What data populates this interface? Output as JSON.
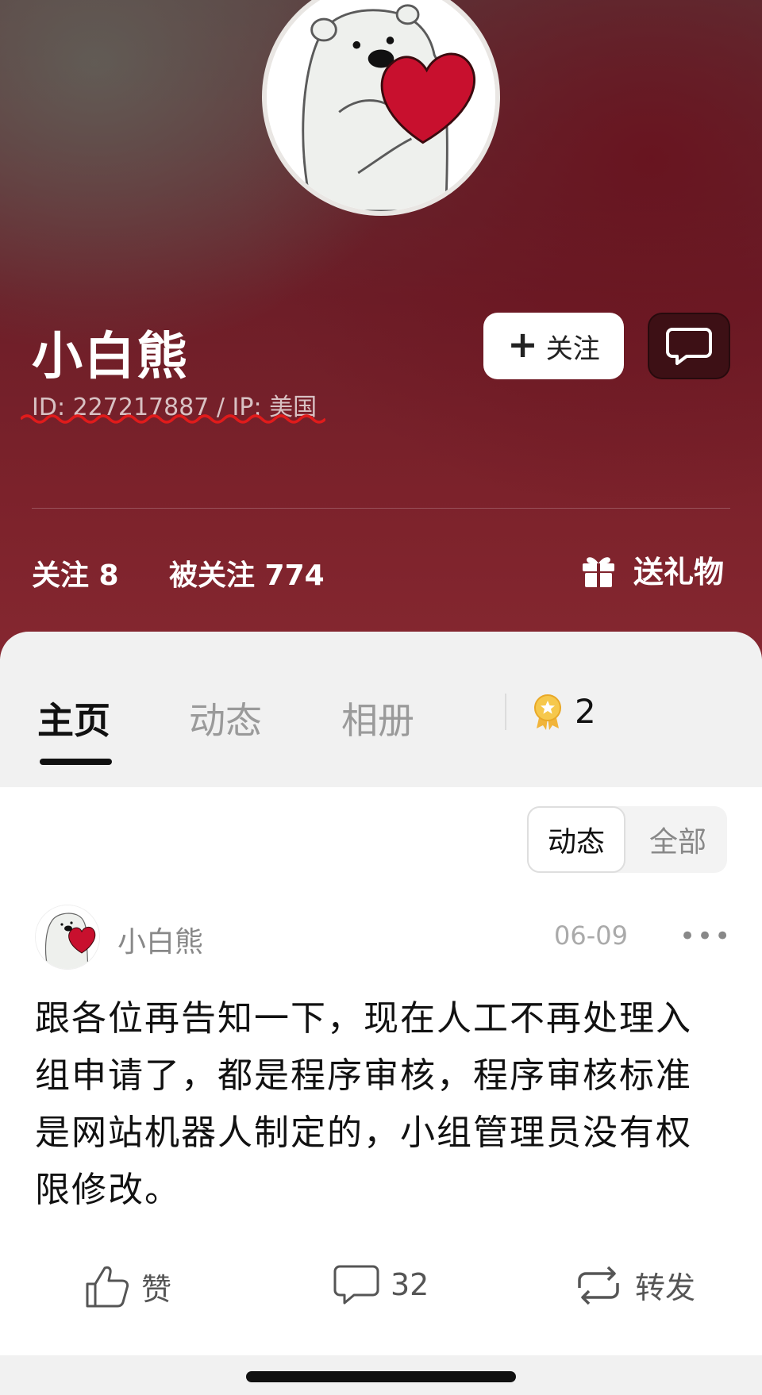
{
  "profile": {
    "name": "小白熊",
    "meta": "ID: 227217887 / IP: 美国",
    "avatar_icon": "polar-bear-heart-avatar",
    "follow_label": "关注",
    "follow_icon": "plus-icon",
    "message_icon": "chat-bubble-icon"
  },
  "stats": {
    "following": "关注 8",
    "followers": "被关注 774",
    "gift_label": "送礼物",
    "gift_icon": "gift-icon"
  },
  "tabs": [
    {
      "label": "主页",
      "active": true
    },
    {
      "label": "动态",
      "active": false
    },
    {
      "label": "相册",
      "active": false
    }
  ],
  "badge": {
    "icon": "medal-icon",
    "count": "2"
  },
  "filter": {
    "selected": "动态",
    "other": "全部"
  },
  "post": {
    "author": "小白熊",
    "date": "06-09",
    "more": "•••",
    "text": "跟各位再告知一下，现在人工不再处理入组申请了，都是程序审核，程序审核标准是网站机器人制定的，小组管理员没有权限修改。",
    "like_label": "赞",
    "comment_count": "32",
    "share_label": "转发"
  },
  "colors": {
    "header_red": "#7c222b",
    "header_gray": "#62625a",
    "text_dark": "#111111",
    "muted": "#9a9a9a"
  }
}
